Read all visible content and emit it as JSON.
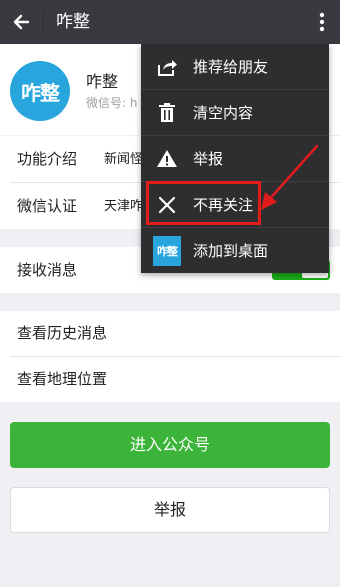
{
  "header": {
    "title": "咋整"
  },
  "profile": {
    "name": "咋整",
    "wechat_id": "微信号: h",
    "avatar_text": "咋整"
  },
  "info": [
    {
      "label": "功能介绍",
      "value": "新闻怪"
    },
    {
      "label": "微信认证",
      "value": "天津咋"
    }
  ],
  "receive": {
    "label": "接收消息",
    "enabled": true
  },
  "history": [
    {
      "label": "查看历史消息"
    },
    {
      "label": "查看地理位置"
    }
  ],
  "buttons": {
    "enter": "进入公众号",
    "report": "举报"
  },
  "menu": {
    "items": [
      {
        "label": "推荐给朋友",
        "icon": "share-icon"
      },
      {
        "label": "清空内容",
        "icon": "trash-icon"
      },
      {
        "label": "举报",
        "icon": "warning-icon"
      },
      {
        "label": "不再关注",
        "icon": "close-icon"
      },
      {
        "label": "添加到桌面",
        "icon": "app-icon",
        "icon_text": "咋整"
      }
    ]
  },
  "colors": {
    "topbar": "#393a3f",
    "green": "#3cb43a",
    "highlight": "#e21b1b",
    "menu_bg": "#2e2e31"
  }
}
